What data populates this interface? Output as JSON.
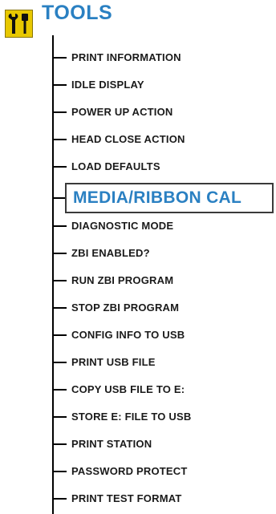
{
  "header": {
    "title": "TOOLS",
    "icon": "tools-icon",
    "icon_color": "#e8c800",
    "title_color": "#2a80c2"
  },
  "menu": {
    "selected_index": 5,
    "items": [
      {
        "label": "PRINT INFORMATION"
      },
      {
        "label": "IDLE DISPLAY"
      },
      {
        "label": "POWER UP ACTION"
      },
      {
        "label": "HEAD CLOSE ACTION"
      },
      {
        "label": "LOAD DEFAULTS"
      },
      {
        "label": "MEDIA/RIBBON CAL"
      },
      {
        "label": "DIAGNOSTIC MODE"
      },
      {
        "label": "ZBI ENABLED?"
      },
      {
        "label": "RUN ZBI PROGRAM"
      },
      {
        "label": "STOP ZBI PROGRAM"
      },
      {
        "label": "CONFIG INFO TO USB"
      },
      {
        "label": "PRINT USB FILE"
      },
      {
        "label": "COPY USB FILE TO E:"
      },
      {
        "label": "STORE E: FILE TO USB"
      },
      {
        "label": "PRINT STATION"
      },
      {
        "label": "PASSWORD PROTECT"
      },
      {
        "label": "PRINT TEST FORMAT"
      }
    ]
  }
}
